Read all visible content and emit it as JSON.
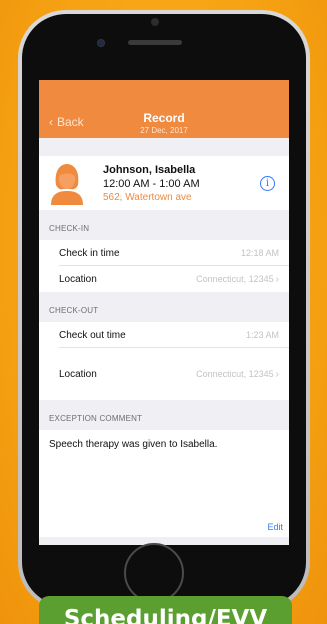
{
  "navbar": {
    "back_label": "Back",
    "title": "Record",
    "date": "27 Dec, 2017"
  },
  "patient": {
    "name": "Johnson, Isabella",
    "time": "12:00 AM - 1:00 AM",
    "address": "562, Watertown ave",
    "info_icon": "info-icon"
  },
  "check_in": {
    "header": "CHECK-IN",
    "time_label": "Check in time",
    "time_value": "12:18 AM",
    "location_label": "Location",
    "location_value": "Connecticut, 12345"
  },
  "check_out": {
    "header": "CHECK-OUT",
    "time_label": "Check out time",
    "time_value": "1:23 AM",
    "location_label": "Location",
    "location_value": "Connecticut, 12345"
  },
  "exception": {
    "header": "EXCEPTION COMMENT",
    "text": "Speech therapy was given to Isabella.",
    "edit_label": "Edit"
  },
  "banner": {
    "text": "Scheduling/EVV"
  },
  "colors": {
    "accent": "#ef8a3f",
    "link": "#3478f6",
    "banner": "#5a9f2f",
    "background": "#f7a414"
  }
}
